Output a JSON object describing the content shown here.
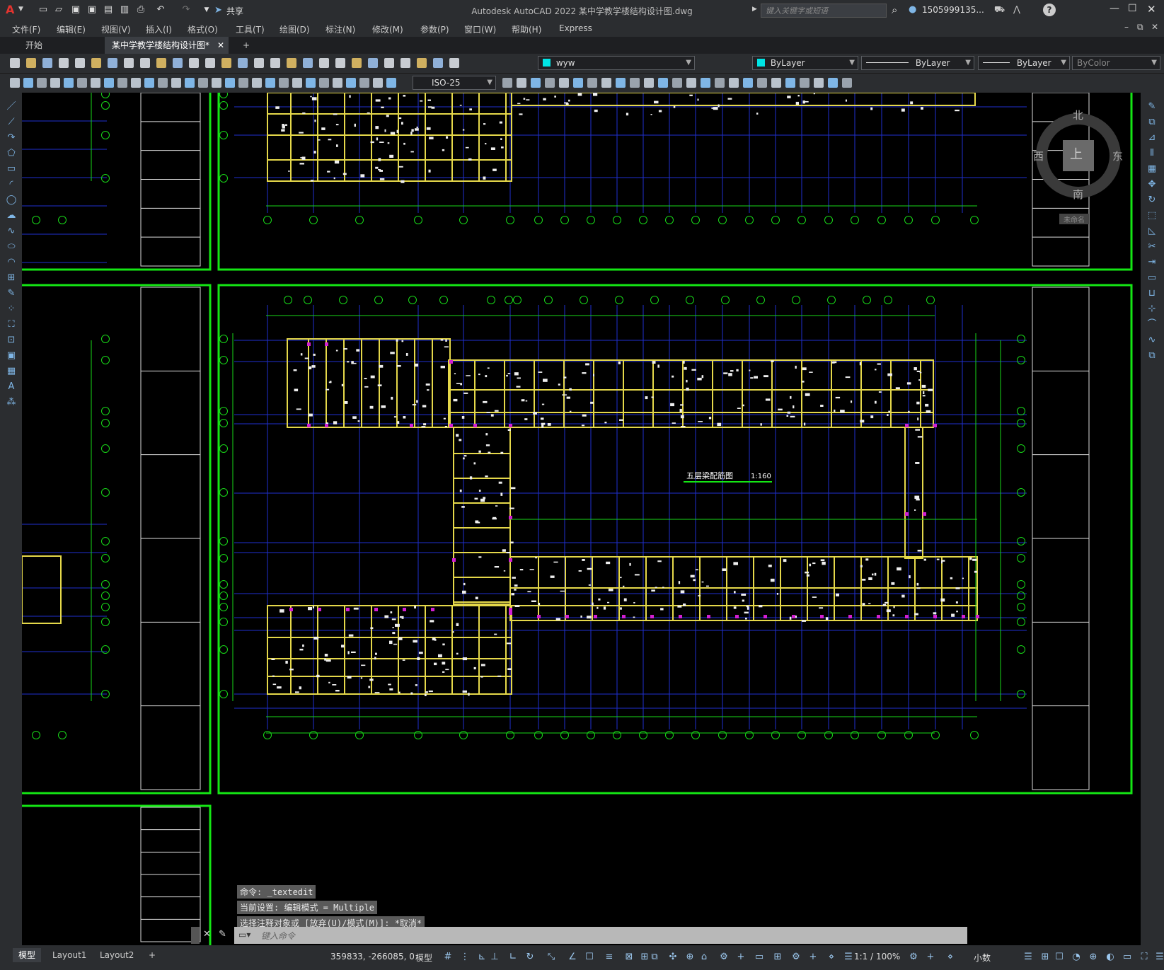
{
  "app": {
    "logo": "A",
    "title": "Autodesk AutoCAD 2022    某中学教学楼结构设计图.dwg",
    "share_label": "共享",
    "search_placeholder": "键入关键字或短语",
    "user": "1505999135...",
    "help_icon": "?"
  },
  "menus": [
    "文件(F)",
    "编辑(E)",
    "视图(V)",
    "插入(I)",
    "格式(O)",
    "工具(T)",
    "绘图(D)",
    "标注(N)",
    "修改(M)",
    "参数(P)",
    "窗口(W)",
    "帮助(H)",
    "Express"
  ],
  "tabs": {
    "start": "开始",
    "drawing": "某中学教学楼结构设计图*",
    "close": "✕",
    "add": "+"
  },
  "layer": {
    "name": "wyw",
    "color": "#00e5e5"
  },
  "properties": {
    "color": "ByLayer",
    "linetype": "ByLayer",
    "lineweight": "ByLayer",
    "plotstyle": "ByColor"
  },
  "dimstyle": "ISO-25",
  "drawing": {
    "plan_title": "五层梁配筋图",
    "plan_scale": "1:160",
    "compass": {
      "north": "北",
      "south": "南",
      "west": "西",
      "east": "东",
      "top": "上",
      "wcs": "未命名"
    }
  },
  "command": {
    "history": [
      "命令: _textedit",
      "当前设置: 编辑模式 = Multiple",
      "选择注释对象或 [放弃(U)/模式(M)]: *取消*"
    ],
    "placeholder": "键入命令"
  },
  "status": {
    "layout_tabs": [
      "模型",
      "Layout1",
      "Layout2"
    ],
    "add_tab": "+",
    "coords": "359833, -266085, 0",
    "space": "模型",
    "scale": "1:1 / 100%",
    "units": "小数"
  }
}
